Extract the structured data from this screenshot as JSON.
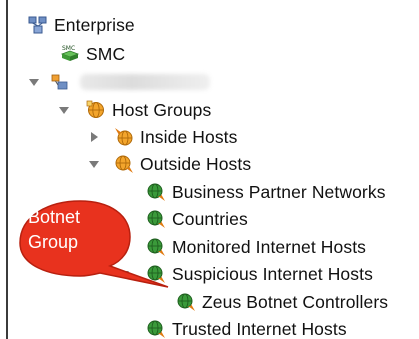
{
  "tree": {
    "root": {
      "label": "Enterprise",
      "icon": "enterprise-icon"
    },
    "smc": {
      "label": "SMC",
      "icon": "smc-server-icon",
      "badge": "SMC"
    },
    "domain": {
      "label": "",
      "icon": "domain-icon",
      "expanded": true
    },
    "host_groups": {
      "label": "Host Groups",
      "icon": "host-groups-icon",
      "expanded": true
    },
    "inside_hosts": {
      "label": "Inside Hosts",
      "icon": "inside-hosts-icon",
      "expanded": false
    },
    "outside_hosts": {
      "label": "Outside Hosts",
      "icon": "outside-hosts-icon",
      "expanded": true
    },
    "business_partner": {
      "label": "Business Partner Networks",
      "icon": "host-group-icon"
    },
    "countries": {
      "label": "Countries",
      "icon": "host-group-icon"
    },
    "monitored": {
      "label": "Monitored Internet Hosts",
      "icon": "host-group-icon"
    },
    "suspicious": {
      "label": "Suspicious Internet Hosts",
      "icon": "host-group-icon",
      "expanded": true
    },
    "zeus": {
      "label": "Zeus Botnet Controllers",
      "icon": "host-group-icon"
    },
    "trusted": {
      "label": "Trusted Internet Hosts",
      "icon": "host-group-icon"
    }
  },
  "callout": {
    "line1": "Botnet",
    "line2": "Group",
    "color": "#e8321e"
  },
  "colors": {
    "globe_green": "#2f8f2f",
    "arrow_orange": "#e07a10",
    "expander_gray": "#7a7a7a"
  }
}
